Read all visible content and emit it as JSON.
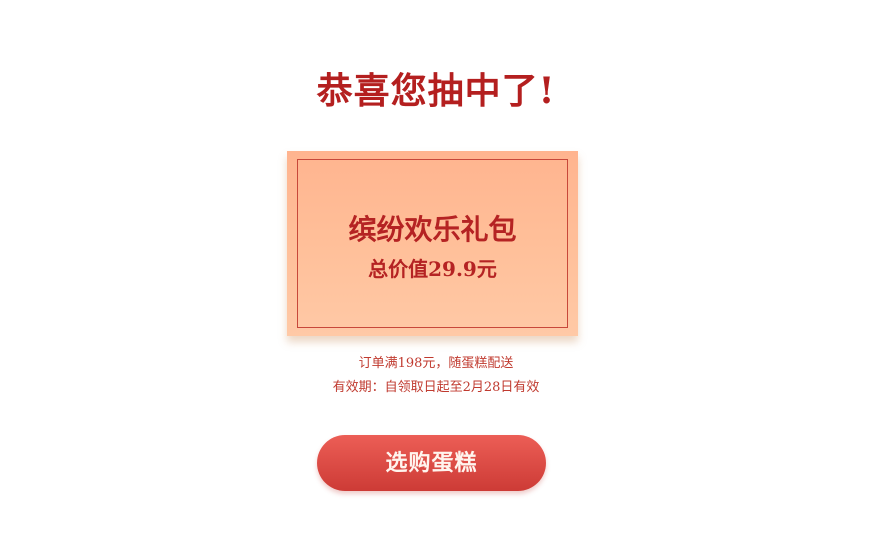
{
  "header": {
    "title": "恭喜您抽中了!"
  },
  "prize_card": {
    "name": "缤纷欢乐礼包",
    "value_text": "总价值29.9元"
  },
  "info": {
    "condition": "订单满198元，随蛋糕配送",
    "validity": "有效期：自领取日起至2月28日有效"
  },
  "action": {
    "button_label": "选购蛋糕"
  },
  "colors": {
    "title": "#b41f1f",
    "card_background": "#ffbf99",
    "card_border": "#c8483a",
    "card_text": "#b52323",
    "info_text": "#c03a2f",
    "button": "#db4a44",
    "button_text": "#fff4ee"
  }
}
